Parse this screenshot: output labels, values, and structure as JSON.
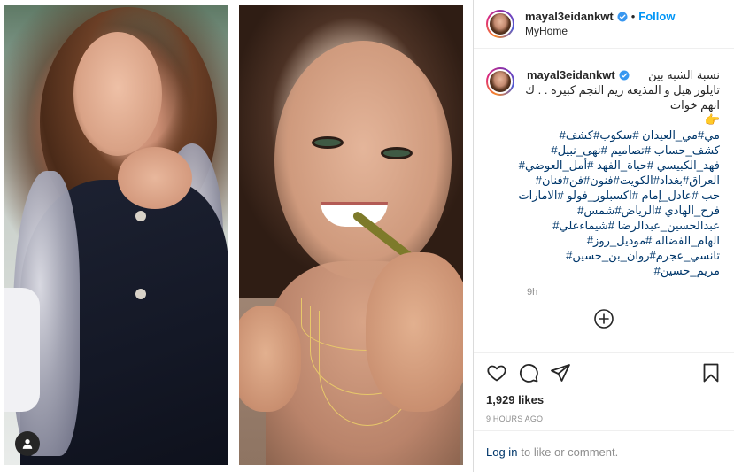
{
  "post": {
    "username": "mayal3eidankwt",
    "location": "MyHome",
    "follow_label": "Follow",
    "separator": "•",
    "caption_lines": [
      "نسبة الشبه بين",
      "تايلور هيل و المذيعه ريم النجم كبيره . . ك",
      "انهم خوات"
    ],
    "caption_emoji": "👉",
    "hashtag_lines": [
      "مي#مي_العيدان #سكوب#كشف#",
      "كشف_حساب #تصاميم #نهى_نبيل#",
      "فهد_الكبيسي #حياة_الفهد #أمل_العوضي#",
      "العراق#بغداد#الكويت#فنون#فن#فنان#",
      "حب #عادل_إمام #اكسبلور_فولو #الامارات",
      "فرح_الهادي #الرياض#شمس#",
      "عبدالحسين_عبدالرضا #شيماءعلي#",
      "الهام_الفضاله #موديل_روز#",
      "تانسي_عجرم#روان_بن_حسين#",
      "مريم_حسين#"
    ],
    "caption_time": "9h",
    "likes": "1,929 likes",
    "posted_ago": "9 HOURS AGO",
    "login_link": "Log in",
    "login_text": "to like or comment."
  },
  "icons": {
    "verified": "verified-badge-icon",
    "like": "heart-icon",
    "comment": "comment-icon",
    "share": "paper-plane-icon",
    "save": "bookmark-icon",
    "load_more": "plus-circle-icon",
    "user_tag": "user-tag-icon"
  },
  "colors": {
    "follow": "#0095f6",
    "verified": "#3897f0",
    "hashtag": "#00376b",
    "muted": "#8e8e8e",
    "text": "#262626"
  }
}
